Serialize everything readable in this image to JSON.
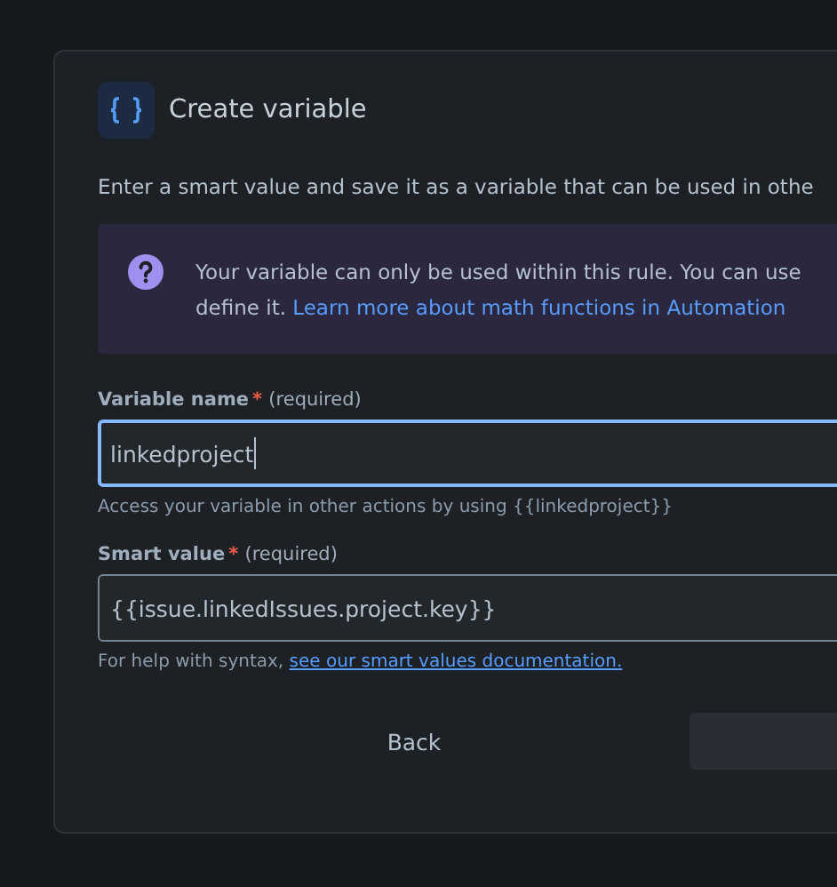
{
  "dialog": {
    "title": "Create variable",
    "description": "Enter a smart value and save it as a variable that can be used in othe",
    "info": {
      "line1": "Your variable can only be used within this rule. You can use",
      "line2": "define it.",
      "link": "Learn more about math functions in Automation"
    },
    "fields": [
      {
        "label": "Variable name",
        "required_mark": "*",
        "required_text": "(required)",
        "value": "linkedproject",
        "focused": true,
        "help": "Access your variable in other actions by using {{linkedproject}}"
      },
      {
        "label": "Smart value",
        "required_mark": "*",
        "required_text": "(required)",
        "value": "{{issue.linkedIssues.project.key}}",
        "focused": false,
        "help": "For help with syntax,",
        "help_link": "see our smart values documentation."
      }
    ],
    "buttons": [
      {
        "label": "Back",
        "kind": "subtle"
      },
      {
        "kind": "default"
      }
    ]
  }
}
